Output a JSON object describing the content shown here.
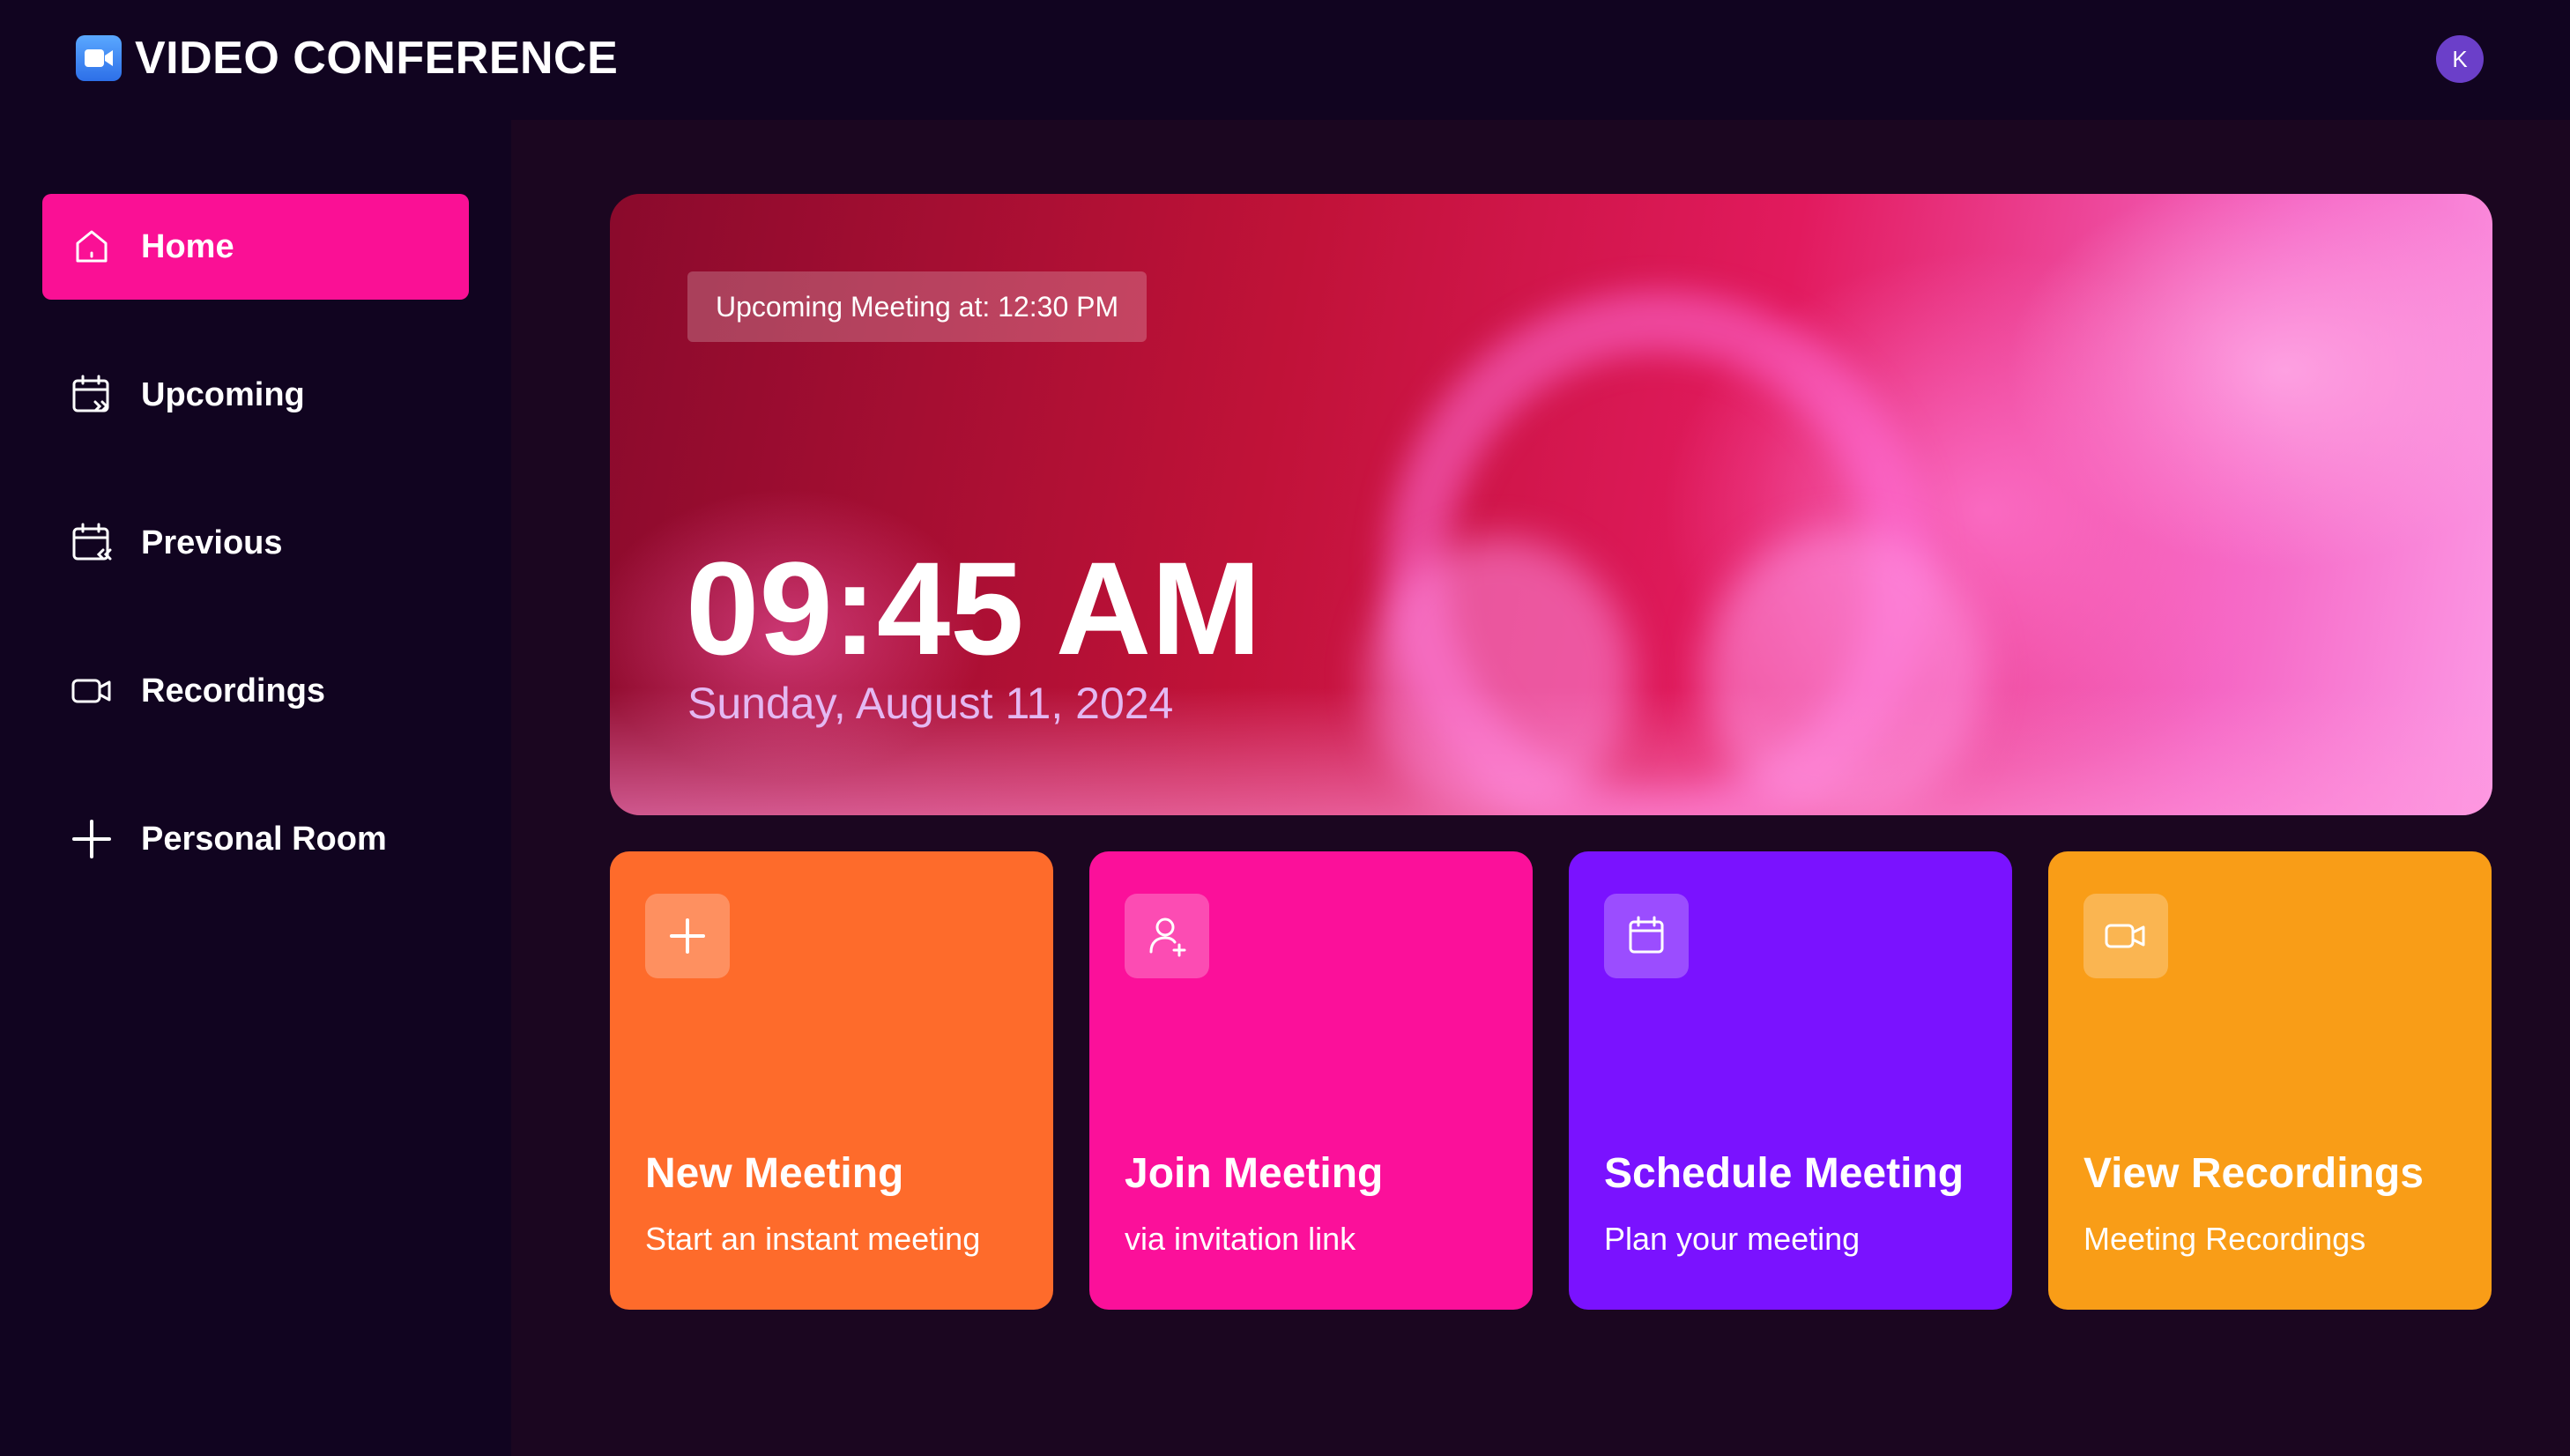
{
  "app": {
    "title": "VIDEO CONFERENCE"
  },
  "user": {
    "avatar_initial": "K"
  },
  "sidebar": {
    "items": [
      {
        "label": "Home",
        "icon": "home-icon",
        "active": true
      },
      {
        "label": "Upcoming",
        "icon": "calendar-forward-icon",
        "active": false
      },
      {
        "label": "Previous",
        "icon": "calendar-back-icon",
        "active": false
      },
      {
        "label": "Recordings",
        "icon": "video-icon",
        "active": false
      },
      {
        "label": "Personal Room",
        "icon": "plus-icon",
        "active": false
      }
    ]
  },
  "hero": {
    "upcoming_text": "Upcoming Meeting at: 12:30 PM",
    "time": "09:45 AM",
    "date": "Sunday, August 11, 2024"
  },
  "cards": [
    {
      "title": "New Meeting",
      "subtitle": "Start an instant meeting",
      "icon": "plus-icon",
      "color": "#fe6b2b"
    },
    {
      "title": "Join Meeting",
      "subtitle": "via invitation link",
      "icon": "user-plus-icon",
      "color": "#fb109a"
    },
    {
      "title": "Schedule Meeting",
      "subtitle": "Plan your meeting",
      "icon": "calendar-icon",
      "color": "#7a12ff"
    },
    {
      "title": "View Recordings",
      "subtitle": "Meeting Recordings",
      "icon": "video-icon",
      "color": "#f99d17"
    }
  ],
  "colors": {
    "background": "#110420",
    "main_background": "#1b0620",
    "accent": "#fa1095",
    "avatar": "#6b3fc9"
  }
}
